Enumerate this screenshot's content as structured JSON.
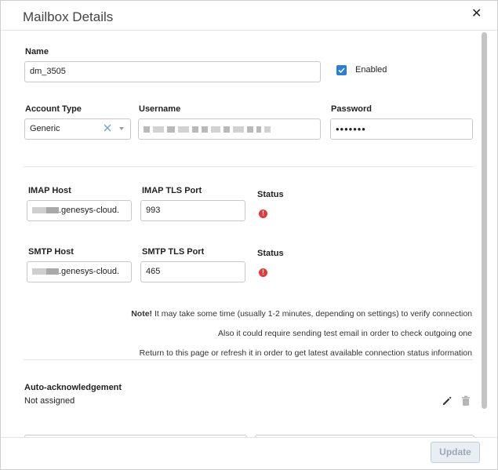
{
  "dialog": {
    "title": "Mailbox Details",
    "close_glyph": "✕"
  },
  "name": {
    "label": "Name",
    "value": "dm_3505"
  },
  "enabled": {
    "label": "Enabled",
    "checked": true
  },
  "account_type": {
    "label": "Account Type",
    "value": "Generic"
  },
  "username": {
    "label": "Username",
    "value_redacted": true
  },
  "password": {
    "label": "Password",
    "value": "•••••••"
  },
  "imap": {
    "host_label": "IMAP Host",
    "host_value": ".genesys-cloud.",
    "port_label": "IMAP TLS Port",
    "port_value": "993",
    "status_label": "Status",
    "status_icon": "error-icon"
  },
  "smtp": {
    "host_label": "SMTP Host",
    "host_value": ".genesys-cloud.",
    "port_label": "SMTP TLS Port",
    "port_value": "465",
    "status_label": "Status",
    "status_icon": "error-icon"
  },
  "notes": {
    "bold_prefix": "Note!",
    "line1": " It may take some time (usually 1-2 minutes, depending on settings) to verify connection",
    "line2": "Also it could require sending test email in order to check outgoing one",
    "line3": "Return to this page or refresh it in order to get latest available connection status information"
  },
  "auto_ack": {
    "title": "Auto-acknowledgement",
    "value": "Not assigned"
  },
  "footer": {
    "update_label": "Update"
  },
  "colors": {
    "accent": "#2a7fd4",
    "error": "#e23a3a",
    "disabled_button_bg": "#e9eef3",
    "disabled_button_text": "#9aa9b7"
  }
}
